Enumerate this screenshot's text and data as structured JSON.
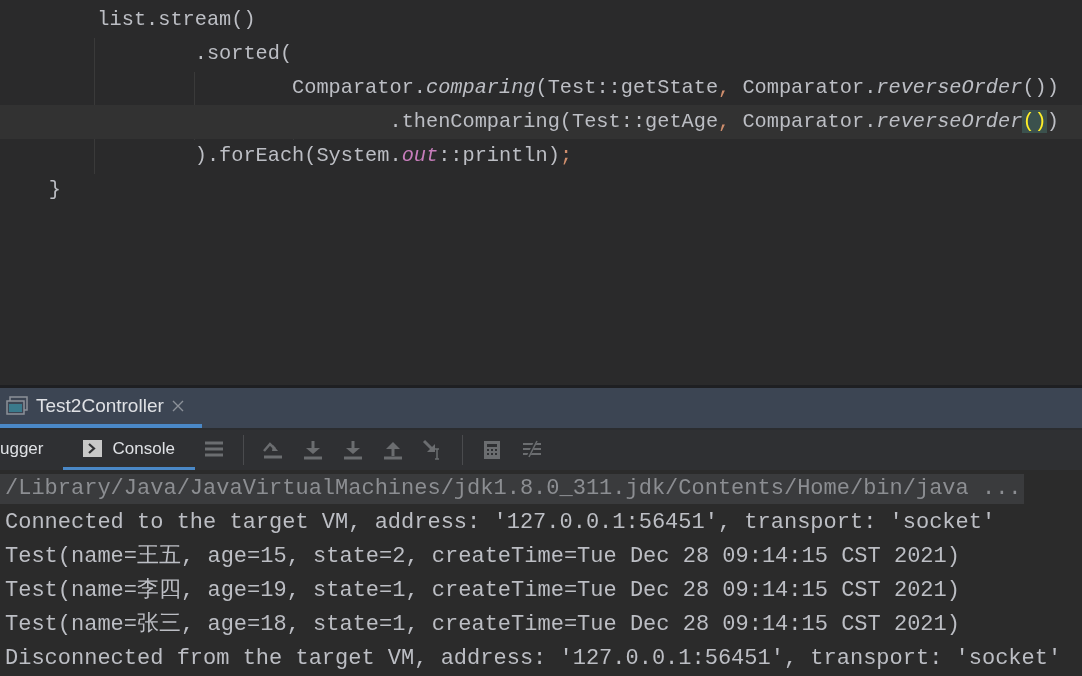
{
  "editor": {
    "lines": [
      {
        "current": false,
        "segments": [
          {
            "text": "        list.stream()",
            "kind": "plain"
          }
        ]
      },
      {
        "current": false,
        "segments": [
          {
            "text": "                .sorted(",
            "kind": "plain"
          }
        ]
      },
      {
        "current": false,
        "segments": [
          {
            "text": "                        Comparator.",
            "kind": "plain"
          },
          {
            "text": "comparing",
            "kind": "italic"
          },
          {
            "text": "(Test::getState",
            "kind": "plain"
          },
          {
            "text": ",",
            "kind": "keyword"
          },
          {
            "text": " Comparator.",
            "kind": "plain"
          },
          {
            "text": "reverseOrder",
            "kind": "italic"
          },
          {
            "text": "())",
            "kind": "plain"
          }
        ]
      },
      {
        "current": true,
        "segments": [
          {
            "text": "                                .thenComparing(Test::getAge",
            "kind": "plain"
          },
          {
            "text": ",",
            "kind": "keyword"
          },
          {
            "text": " Comparator.",
            "kind": "plain"
          },
          {
            "text": "reverseOrder",
            "kind": "italic"
          },
          {
            "text": "()",
            "kind": "match"
          },
          {
            "text": ")",
            "kind": "plain"
          }
        ]
      },
      {
        "current": false,
        "segments": [
          {
            "text": "                ).forEach(System.",
            "kind": "plain"
          },
          {
            "text": "out",
            "kind": "field"
          },
          {
            "text": "::println)",
            "kind": "plain"
          },
          {
            "text": ";",
            "kind": "keyword"
          }
        ]
      },
      {
        "current": false,
        "segments": [
          {
            "text": "    }",
            "kind": "plain"
          }
        ]
      }
    ]
  },
  "run_panel": {
    "tabs": [
      {
        "label": "Test2Controller",
        "selected": true
      }
    ],
    "subtabs": [
      {
        "label": "ugger",
        "selected": false
      },
      {
        "label": "Console",
        "selected": true
      }
    ],
    "console": [
      {
        "text": "/Library/Java/JavaVirtualMachines/jdk1.8.0_311.jdk/Contents/Home/bin/java ...",
        "kind": "command"
      },
      {
        "text": "Connected to the target VM, address: '127.0.0.1:56451', transport: 'socket'",
        "kind": "output"
      },
      {
        "text": "Test(name=王五, age=15, state=2, createTime=Tue Dec 28 09:14:15 CST 2021)",
        "kind": "output"
      },
      {
        "text": "Test(name=李四, age=19, state=1, createTime=Tue Dec 28 09:14:15 CST 2021)",
        "kind": "output"
      },
      {
        "text": "Test(name=张三, age=18, state=1, createTime=Tue Dec 28 09:14:15 CST 2021)",
        "kind": "output"
      },
      {
        "text": "Disconnected from the target VM, address: '127.0.0.1:56451', transport: 'socket'",
        "kind": "output"
      }
    ]
  }
}
